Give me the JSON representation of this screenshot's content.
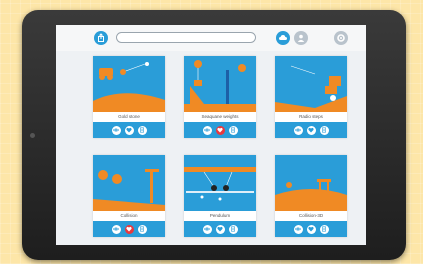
{
  "app": {
    "search": {
      "placeholder": ""
    }
  },
  "colors": {
    "accent": "#2a9dd8",
    "ground": "#f08a24",
    "like": "#e8383d"
  },
  "toolbar": {
    "left_icon": "share-icon",
    "right_icons": [
      "cloud-icon",
      "user-icon",
      "settings-icon"
    ]
  },
  "cards": [
    {
      "title": "Gold stone",
      "liked": false
    },
    {
      "title": "Seaquane weights",
      "liked": true
    },
    {
      "title": "Radio steps",
      "liked": false
    },
    {
      "title": "Collision",
      "liked": true
    },
    {
      "title": "Pendulum",
      "liked": false
    },
    {
      "title": "Collision-3D",
      "liked": false
    }
  ]
}
